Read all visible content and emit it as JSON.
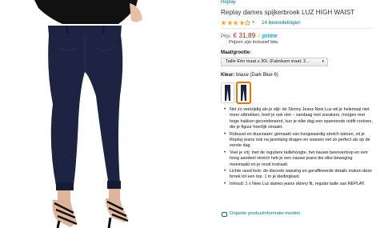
{
  "product": {
    "brand": "Replay",
    "title": "Replay dames spijkerbroek LUZ HIGH WAIST",
    "rating_stars": 4,
    "reviews_label": "14 beoordelingen",
    "price_label": "Prijs:",
    "price": "€ 31,89",
    "prime_label": "prime",
    "vat_note": "Prijzen zijn inclusief btw.",
    "size_label": "Maat/grootte:",
    "size_selected": "Taille Eén maat x 30L (Fabrikant maat: 2...",
    "color_label": "Kleur:",
    "color_value": "blauw (Dark Blue 9)",
    "bullets": [
      "Net zo veelzijdig als je stijl: de Skinny Jeans New Luz wil je helemaal niet meer uittrekken, hoef je ook niet – vandaag met sneakers, morgen met hoge hakken gecombineerd, kun je elke dag een spannende outfit creëren, die je figuur heerlijk smaakt.",
      "Robuust en duurzaam: gemaakt van hoogwaardig stretch katoen, zit je Replay jeans ook na jarenlang dragen en wassen net zo perfect als op de eerste dag.",
      "Voel je vrij: met de reguliere taillehoogte, het nauwe beenverloop en een hoog aandeel stretch heb je een nauwe jeans die elke beweging meemaakt en je nooit instraalt.",
      "Lichte used look: de discrete wassing en geraffineerde details maken deze broek tot een top. 1 in je kledingkast.",
      "Inhoud: 1 x New Luz dames jeans skinny fit, regular taille van REPLAY."
    ],
    "report_link": "Onjuiste productinformatie melden."
  },
  "colors": {
    "star": "#ffa41c",
    "link": "#007185",
    "price": "#b12704",
    "prime": "#00a8e1",
    "denim": "#1c2441",
    "selected_border": "#e77600"
  },
  "icons": {
    "star": "star-icon",
    "prime_check": "prime-check-icon",
    "report": "speech-bubble-icon"
  }
}
